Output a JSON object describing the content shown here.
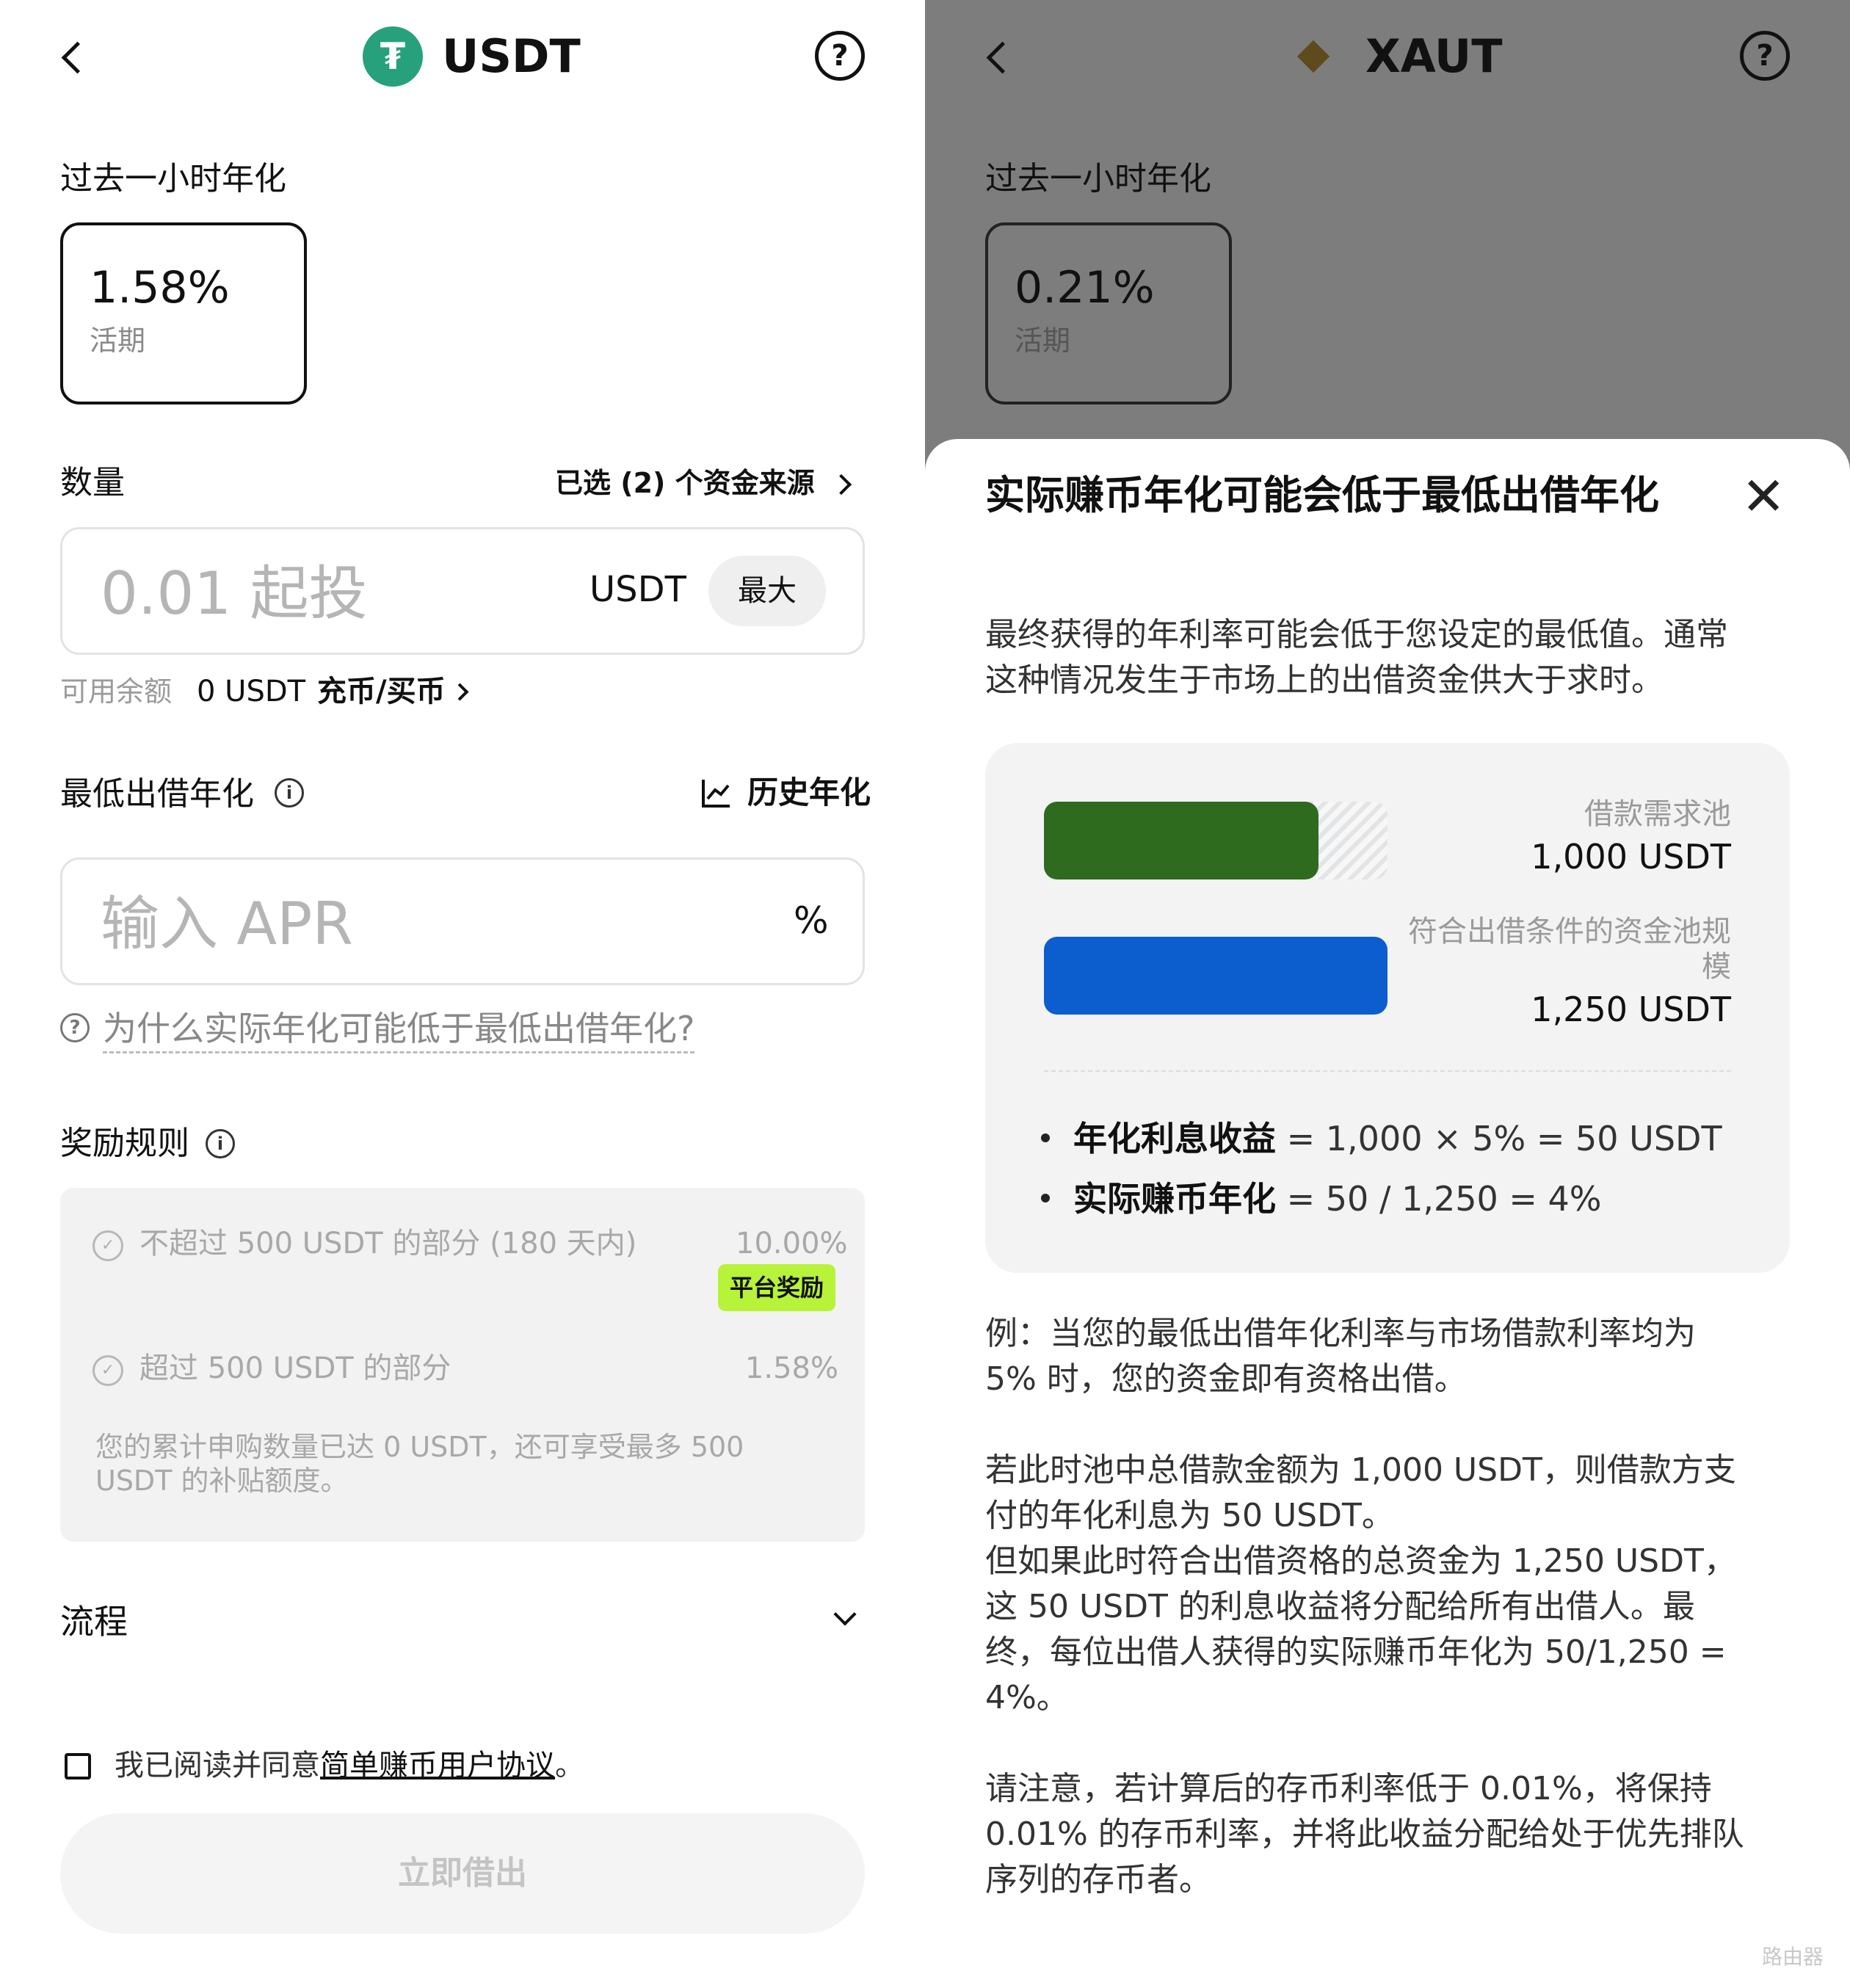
{
  "left": {
    "header": {
      "title": "USDT",
      "coin_glyph": "₮",
      "icons": [
        "back-chevron-icon",
        "usdt-coin-icon",
        "help-icon"
      ]
    },
    "apr_section": {
      "label": "过去一小时年化",
      "rate": "1.58%",
      "rate_type": "活期"
    },
    "amount": {
      "label": "数量",
      "fund_source": "已选 (2) 个资金来源",
      "placeholder": "0.01 起投",
      "currency": "USDT",
      "max_label": "最大",
      "balance_label": "可用余额",
      "balance_value": "0 USDT",
      "deposit_link": "充币/买币"
    },
    "min_apr": {
      "label": "最低出借年化",
      "history_link": "历史年化",
      "placeholder": "输入 APR",
      "unit": "%",
      "why_link": "为什么实际年化可能低于最低出借年化?"
    },
    "rewards": {
      "label": "奖励规则",
      "tiers": [
        {
          "text": "不超过 500 USDT 的部分 (180 天内)",
          "rate": "10.00%",
          "badge": "平台奖励"
        },
        {
          "text": "超过 500 USDT 的部分",
          "rate": "1.58%"
        }
      ],
      "note_line1": "您的累计申购数量已达 0 USDT，还可享受最多 500",
      "note_line2": "USDT 的补贴额度。"
    },
    "process": {
      "label": "流程"
    },
    "agreement": {
      "prefix": "我已阅读并同意",
      "link": "简单赚币用户协议",
      "suffix": "。"
    },
    "submit_label": "立即借出"
  },
  "right": {
    "header": {
      "title": "XAUT",
      "coin_glyph": "◆"
    },
    "apr_section": {
      "label": "过去一小时年化",
      "rate": "0.21%",
      "rate_type": "活期"
    },
    "sheet": {
      "title": "实际赚币年化可能会低于最低出借年化",
      "intro_line1": "最终获得的年利率可能会低于您设定的最低值。通常",
      "intro_line2": "这种情况发生于市场上的出借资金供大于求时。",
      "chart_data": {
        "type": "bar",
        "categories": [
          "借款需求池",
          "符合出借条件的资金池规模"
        ],
        "values": [
          1000,
          1250
        ],
        "unit": "USDT",
        "colors": [
          "#2e6b1f",
          "#0c5ece"
        ]
      },
      "bars": [
        {
          "label": "借款需求池",
          "value": "1,000 USDT"
        },
        {
          "label_line1": "符合出借条件的资金池规",
          "label_line2": "模",
          "value": "1,250 USDT"
        }
      ],
      "formulas": [
        {
          "bold": "年化利息收益",
          "rest": " = 1,000 × 5% = 50 USDT"
        },
        {
          "bold": "实际赚币年化",
          "rest": " = 50 / 1,250 = 4%"
        }
      ],
      "example": [
        "例：当您的最低出借年化利率与市场借款利率均为",
        "5% 时，您的资金即有资格出借。"
      ],
      "explain": [
        "若此时池中总借款金额为 1,000 USDT，则借款方支",
        "付的年化利息为 50 USDT。",
        "但如果此时符合出借资格的总资金为 1,250 USDT，",
        "这 50 USDT 的利息收益将分配给所有出借人。最",
        "终，每位出借人获得的实际赚币年化为 50/1,250 =",
        "4%。"
      ],
      "note": [
        "请注意，若计算后的存币利率低于 0.01%，将保持",
        "0.01% 的存币利率，并将此收益分配给处于优先排队",
        "序列的存币者。"
      ]
    },
    "watermark": "路由器"
  }
}
